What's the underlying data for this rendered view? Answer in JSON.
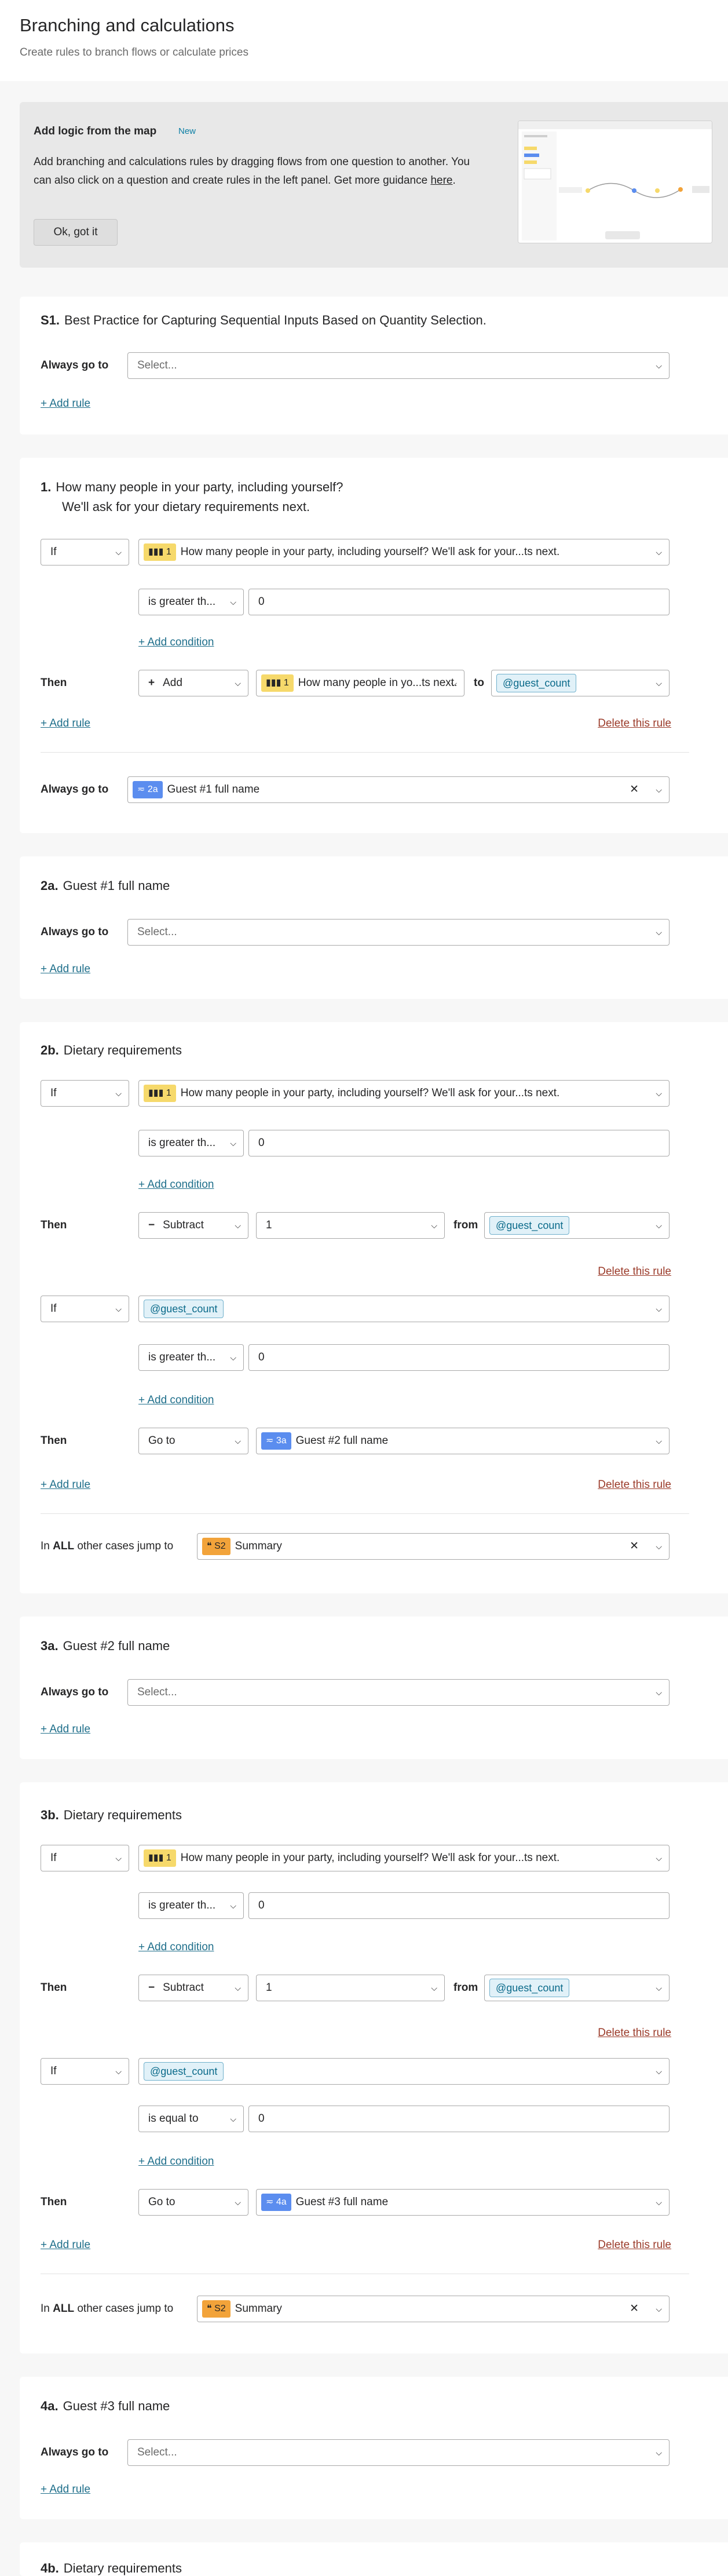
{
  "header": {
    "title": "Branching and calculations",
    "subtitle": "Create rules to branch flows or calculate prices"
  },
  "promo": {
    "title": "Add logic from the map",
    "badge": "New",
    "text_before": "Add branching and calculations rules by dragging flows from one question to another. You can also click on a question and create rules in the left panel. Get more guidance ",
    "link": "here",
    "text_after": ".",
    "button": "Ok, got it"
  },
  "common": {
    "always_go_to": "Always go to",
    "select_placeholder": "Select...",
    "add_rule": "+ Add rule",
    "add_condition": "+ Add condition",
    "delete_rule": "Delete this rule",
    "if": "If",
    "then": "Then",
    "to": "to",
    "from": "from",
    "in": "In",
    "all": "ALL",
    "other_cases": "other cases jump to",
    "chev": "⌵",
    "x": "✕",
    "q1_text": "How many people in your party, including yourself? We'll ask for your...ts next.",
    "q1_short": "How many people in yo...ts next.",
    "greater": "is greater th...",
    "equal": "is equal to",
    "zero": "0",
    "one": "1",
    "guest_count": "@guest_count",
    "add": "Add",
    "subtract": "Subtract",
    "go_to": "Go to",
    "summary": "Summary",
    "s2": "S2",
    "chip_1": "1"
  },
  "s1": {
    "num": "S1.",
    "title": "Best Practice for Capturing Sequential Inputs Based on Quantity Selection."
  },
  "q1": {
    "num": "1.",
    "title": "How many people in your party, including yourself?",
    "subtitle": "We'll ask for your dietary requirements next.",
    "always_chip": "2a",
    "always_value": "Guest #1 full name"
  },
  "q2a": {
    "num": "2a.",
    "title": "Guest #1 full name"
  },
  "q2b": {
    "num": "2b.",
    "title": "Dietary requirements",
    "goto_chip": "3a",
    "goto_value": "Guest #2 full name"
  },
  "q3a": {
    "num": "3a.",
    "title": "Guest #2 full name"
  },
  "q3b": {
    "num": "3b.",
    "title": "Dietary requirements",
    "goto_chip": "4a",
    "goto_value": "Guest #3 full name"
  },
  "q4a": {
    "num": "4a.",
    "title": "Guest #3 full name"
  },
  "q4b": {
    "num": "4b.",
    "title": "Dietary requirements"
  },
  "colors": {
    "accent_link": "#1f6f8b",
    "delete_link": "#9b3b2a",
    "chip_yellow": "#f6d96b",
    "chip_blue": "#5b8def",
    "chip_orange": "#f2a33a",
    "badge_new": "#0a7ea4"
  }
}
